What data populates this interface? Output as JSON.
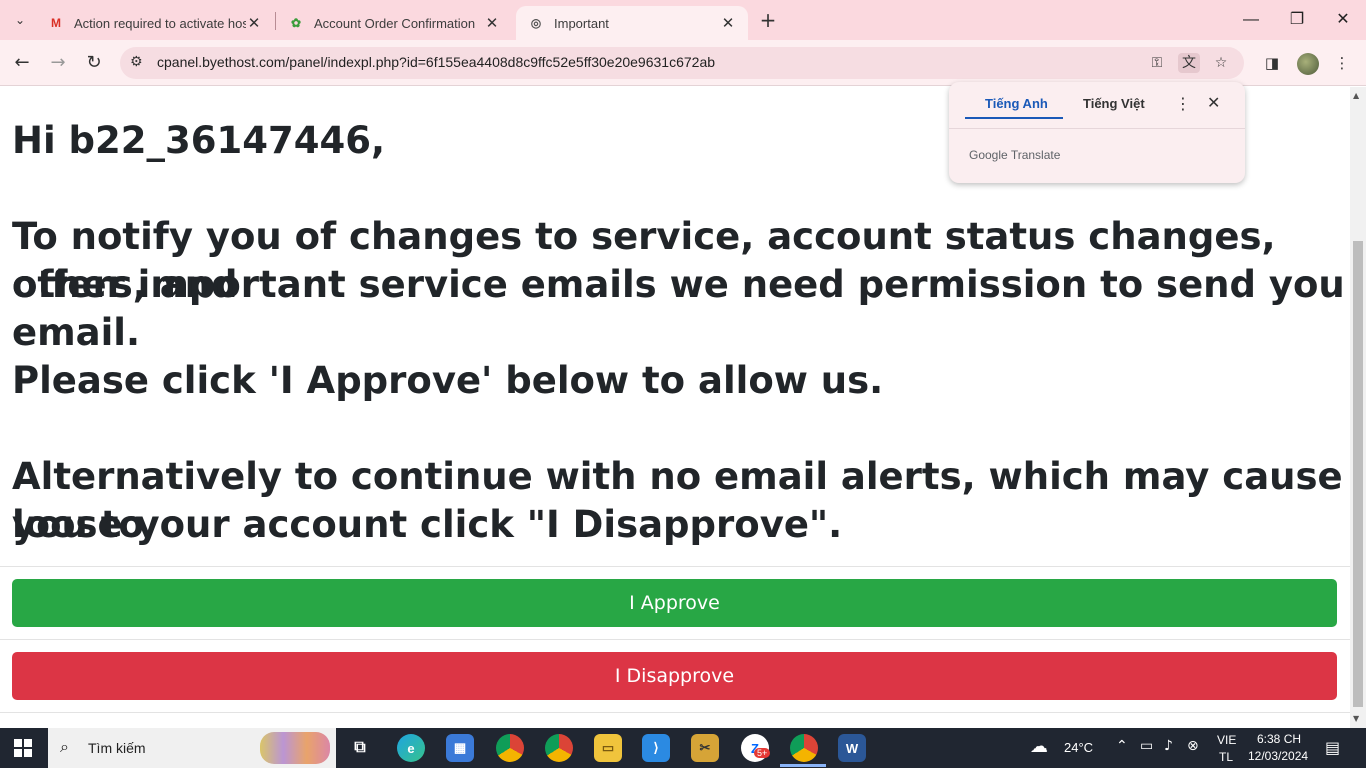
{
  "tabs": [
    {
      "title": "Action required to activate host",
      "icon": "gmail-icon"
    },
    {
      "title": "Account Order Confirmation",
      "icon": "byethost-icon"
    },
    {
      "title": "Important",
      "icon": "globe-icon"
    }
  ],
  "address": {
    "url": "cpanel.byethost.com/panel/indexpl.php?id=6f155ea4408d8c9ffc52e5ff30e20e9631c672ab"
  },
  "page": {
    "greeting": "Hi b22_36147446,",
    "notice_line1": "To notify you of changes to service, account status changes, offers, and",
    "notice_line2": "other important service emails we need permission to send you email.",
    "instruction": "Please click 'I Approve' below to allow us.",
    "alt_line1": "Alternatively to continue with no email alerts, which may cause you to",
    "alt_line2": "loose your account click \"I Disapprove\".",
    "approve_label": "I Approve",
    "disapprove_label": "I Disapprove",
    "approve_color": "#28a745",
    "disapprove_color": "#dc3545"
  },
  "translate": {
    "source_lang": "Tiếng Anh",
    "target_lang": "Tiếng Việt",
    "brand": "Google Translate"
  },
  "taskbar": {
    "search_placeholder": "Tìm kiếm",
    "weather": "24°C",
    "lang_top": "VIE",
    "lang_bottom": "TL",
    "time": "6:38 CH",
    "date": "12/03/2024",
    "zalo_badge": "5+"
  }
}
